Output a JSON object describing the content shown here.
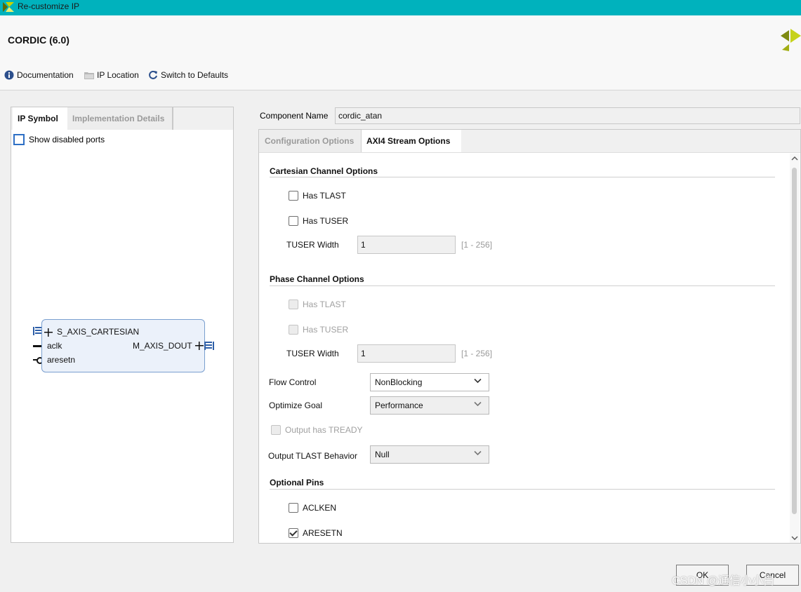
{
  "window": {
    "title": "Re-customize IP"
  },
  "header": {
    "ip_title": "CORDIC (6.0)",
    "toolbar": {
      "documentation": "Documentation",
      "ip_location": "IP Location",
      "switch_defaults": "Switch to Defaults"
    }
  },
  "left_panel": {
    "tabs": [
      {
        "label": "IP Symbol",
        "active": true
      },
      {
        "label": "Implementation Details",
        "active": false
      }
    ],
    "show_disabled_ports": "Show disabled ports",
    "symbol": {
      "port_s_axis": "S_AXIS_CARTESIAN",
      "port_aclk": "aclk",
      "port_aresetn": "aresetn",
      "port_m_axis": "M_AXIS_DOUT"
    }
  },
  "component_name": {
    "label": "Component Name",
    "value": "cordic_atan"
  },
  "right_panel": {
    "tabs": [
      {
        "label": "Configuration Options",
        "active": false
      },
      {
        "label": "AXI4 Stream Options",
        "active": true
      }
    ],
    "cartesian": {
      "title": "Cartesian Channel Options",
      "has_tlast": "Has TLAST",
      "has_tuser": "Has TUSER",
      "tuser_width_label": "TUSER Width",
      "tuser_width_value": "1",
      "tuser_width_range": "[1 - 256]"
    },
    "phase": {
      "title": "Phase Channel Options",
      "has_tlast": "Has TLAST",
      "has_tuser": "Has TUSER",
      "tuser_width_label": "TUSER Width",
      "tuser_width_value": "1",
      "tuser_width_range": "[1 - 256]"
    },
    "flow_control": {
      "label": "Flow Control",
      "value": "NonBlocking"
    },
    "optimize_goal": {
      "label": "Optimize Goal",
      "value": "Performance"
    },
    "output_tready": "Output has TREADY",
    "output_tlast": {
      "label": "Output TLAST Behavior",
      "value": "Null"
    },
    "optional_pins": {
      "title": "Optional Pins",
      "aclken": "ACLKEN",
      "aresetn": "ARESETN"
    }
  },
  "buttons": {
    "ok": "OK",
    "cancel": "Cancel"
  },
  "watermark": "CSDN @通信小小白",
  "colors": {
    "titlebar": "#00b2bd",
    "accent": "#2e6fc5"
  }
}
